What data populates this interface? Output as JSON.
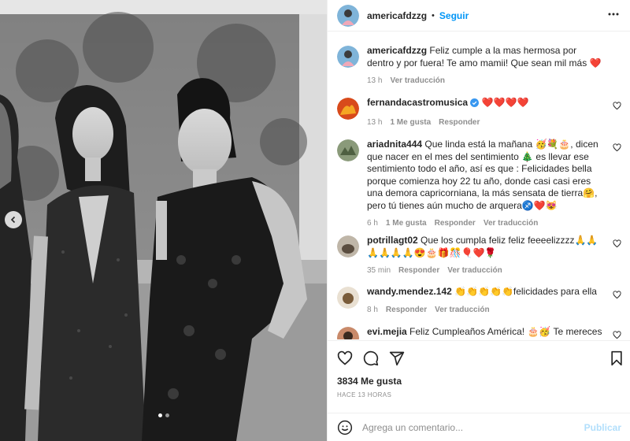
{
  "post": {
    "author": "americafdzzg",
    "follow_label": "Seguir",
    "dot_separator": "•",
    "caption": "Feliz cumple a la mas hermosa por dentro y por fuera! Te amo mamii! Que sean mil más ❤️",
    "caption_time": "13 h",
    "caption_translate": "Ver traducción"
  },
  "comments": [
    {
      "user": "fernandacastromusica",
      "verified": true,
      "text": "❤️❤️❤️❤️",
      "time": "13 h",
      "likes": "1 Me gusta",
      "reply": "Responder",
      "translate": ""
    },
    {
      "user": "ariadnita444",
      "verified": false,
      "text": "Que linda está la mañana 🥳💐🎂, dicen que nacer en el mes del sentimiento 🎄 es llevar ese sentimiento todo el año, así es que : Felicidades bella porque comienza hoy 22 tu año, donde casi casi eres una demora capricorniana, la más sensata de tierra🤗, pero tú tienes aún mucho de arquera♐️❤️😻",
      "time": "6 h",
      "likes": "1 Me gusta",
      "reply": "Responder",
      "translate": "Ver traducción"
    },
    {
      "user": "potrillagt02",
      "verified": false,
      "text": "Que los cumpla feliz feliz feeeelizzzz🙏🙏🙏🙏🙏🙏😍🎂🎁🎊🎈❤️🌹",
      "time": "35 min",
      "likes": "",
      "reply": "Responder",
      "translate": "Ver traducción"
    },
    {
      "user": "wandy.mendez.142",
      "verified": false,
      "text": "👏👏👏👏👏felicidades para ella",
      "time": "8 h",
      "likes": "",
      "reply": "Responder",
      "translate": "Ver traducción"
    },
    {
      "user": "evi.mejia",
      "verified": false,
      "text": "Feliz Cumpleaños América! 🎂🥳 Te mereces lo",
      "time": "",
      "likes": "",
      "reply": "",
      "translate": ""
    }
  ],
  "actions": {
    "likes": "3834 Me gusta",
    "time_ago": "HACE 13 HORAS"
  },
  "add_comment": {
    "placeholder": "Agrega un comentario...",
    "post_label": "Publicar"
  },
  "icons": {
    "more": "more-icon",
    "heart": "heart-icon",
    "comment": "comment-icon",
    "share": "share-icon",
    "bookmark": "bookmark-icon",
    "emoji": "emoji-icon",
    "prev": "chevron-left-icon"
  },
  "colors": {
    "accent": "#0095f6",
    "verified": "#3897f0",
    "muted": "#8e8e8e",
    "post_disabled": "#b2dffc"
  },
  "carousel": {
    "slides": 2,
    "active": 1
  }
}
